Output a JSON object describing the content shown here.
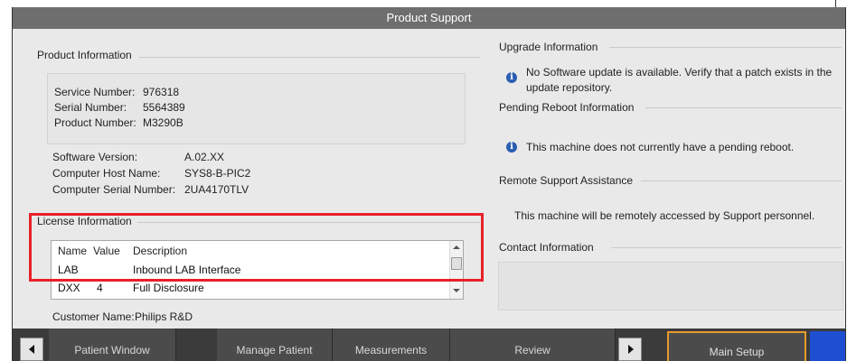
{
  "window": {
    "title": "Product Support"
  },
  "product_info": {
    "title": "Product Information",
    "service_label": "Service Number:",
    "service_value": "976318",
    "serial_label": "Serial Number:",
    "serial_value": "5564389",
    "product_label": "Product Number:",
    "product_value": "M3290B",
    "software_label": "Software Version:",
    "software_value": "A.02.XX",
    "host_label": "Computer Host Name:",
    "host_value": "SYS8-B-PIC2",
    "comp_serial_label": "Computer Serial Number:",
    "comp_serial_value": "2UA4170TLV"
  },
  "license_info": {
    "title": "License Information",
    "columns": [
      "Name",
      "Value",
      "Description"
    ],
    "rows": [
      {
        "name": "LAB",
        "value": "",
        "description": "Inbound LAB Interface"
      },
      {
        "name": "DXX",
        "value": "4",
        "description": "Full Disclosure"
      }
    ]
  },
  "customer": {
    "label": "Customer Name:",
    "value": "Philips R&D"
  },
  "upgrade_info": {
    "title": "Upgrade Information",
    "message_line1": "No Software update is available. Verify that a patch exists in the",
    "message_line2": "update repository."
  },
  "pending_reboot": {
    "title": "Pending Reboot Information",
    "message": "This machine does not currently have a pending reboot."
  },
  "remote_support": {
    "title": "Remote Support Assistance",
    "message": "This machine will be remotely accessed by Support personnel."
  },
  "contact_info": {
    "title": "Contact Information"
  },
  "tabs": {
    "patient_window": "Patient Window",
    "manage_patient": "Manage Patient",
    "measurements": "Measurements",
    "review": "Review",
    "main_setup": "Main Setup"
  },
  "icons": {
    "info": "info-icon",
    "prev": "chevron-left-icon",
    "next": "chevron-right-icon"
  },
  "colors": {
    "highlight": "#e8202a",
    "active_tab_border": "#e89a2a",
    "accent_blue": "#1f4fd1"
  }
}
